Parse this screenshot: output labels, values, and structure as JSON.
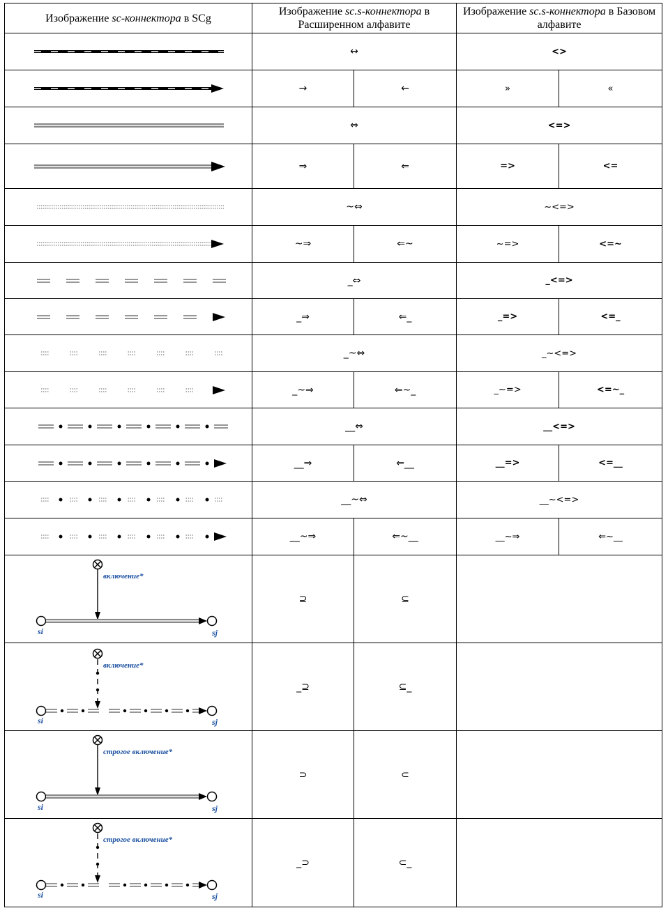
{
  "header": {
    "col1": "Изображение ",
    "col1_italic": "sc-коннектора",
    "col1_tail": " в SCg",
    "col2_a": "Изображение ",
    "col2_italic": "sc.s-коннектора",
    "col2_b": " в Расширенном алфавите",
    "col3_a": "Изображение ",
    "col3_italic": "sc.s-коннектора",
    "col3_b": " в Базовом алфавите"
  },
  "rows": [
    {
      "ext": "↔",
      "basic": "<>"
    },
    {
      "ext": [
        "→",
        "←"
      ],
      "basic": [
        "»",
        "«"
      ]
    },
    {
      "ext": "⇔",
      "basic": "<=>"
    },
    {
      "ext": [
        "⇒",
        "⇐"
      ],
      "basic": [
        "=>",
        "<="
      ]
    },
    {
      "ext": "~⇔",
      "basic": "~<=>"
    },
    {
      "ext": [
        "~⇒",
        "⇐~"
      ],
      "basic": [
        "~=>",
        "<=~"
      ]
    },
    {
      "ext": "_⇔",
      "basic": "_<=>"
    },
    {
      "ext": [
        "_⇒",
        "⇐_"
      ],
      "basic": [
        "_=>",
        "<=_"
      ]
    },
    {
      "ext": "_~⇔",
      "basic": "_~<=>"
    },
    {
      "ext": [
        "_~⇒",
        "⇐~_"
      ],
      "basic": [
        "_~=>",
        "<=~_"
      ]
    },
    {
      "ext": "__⇔",
      "basic": "__<=>"
    },
    {
      "ext": [
        "__⇒",
        "⇐__"
      ],
      "basic": [
        "__=>",
        "<=__"
      ]
    },
    {
      "ext": "__~⇔",
      "basic": "__~<=>"
    },
    {
      "ext": [
        "__~⇒",
        "⇐~__"
      ],
      "basic": [
        "__~⇒",
        "⇐~__"
      ]
    },
    {
      "ext": [
        "⊇",
        "⊆"
      ]
    },
    {
      "ext": [
        "_⊇",
        "⊆_"
      ]
    },
    {
      "ext": [
        "⊃",
        "⊂"
      ]
    },
    {
      "ext": [
        "_⊃",
        "⊂_"
      ]
    }
  ],
  "diagram_labels": {
    "inclusion": "включение*",
    "strict_inclusion": "строгое включение*",
    "si": "si",
    "sj": "sj"
  },
  "colors": {
    "label_blue": "#1a4fa0",
    "border": "#000000"
  }
}
